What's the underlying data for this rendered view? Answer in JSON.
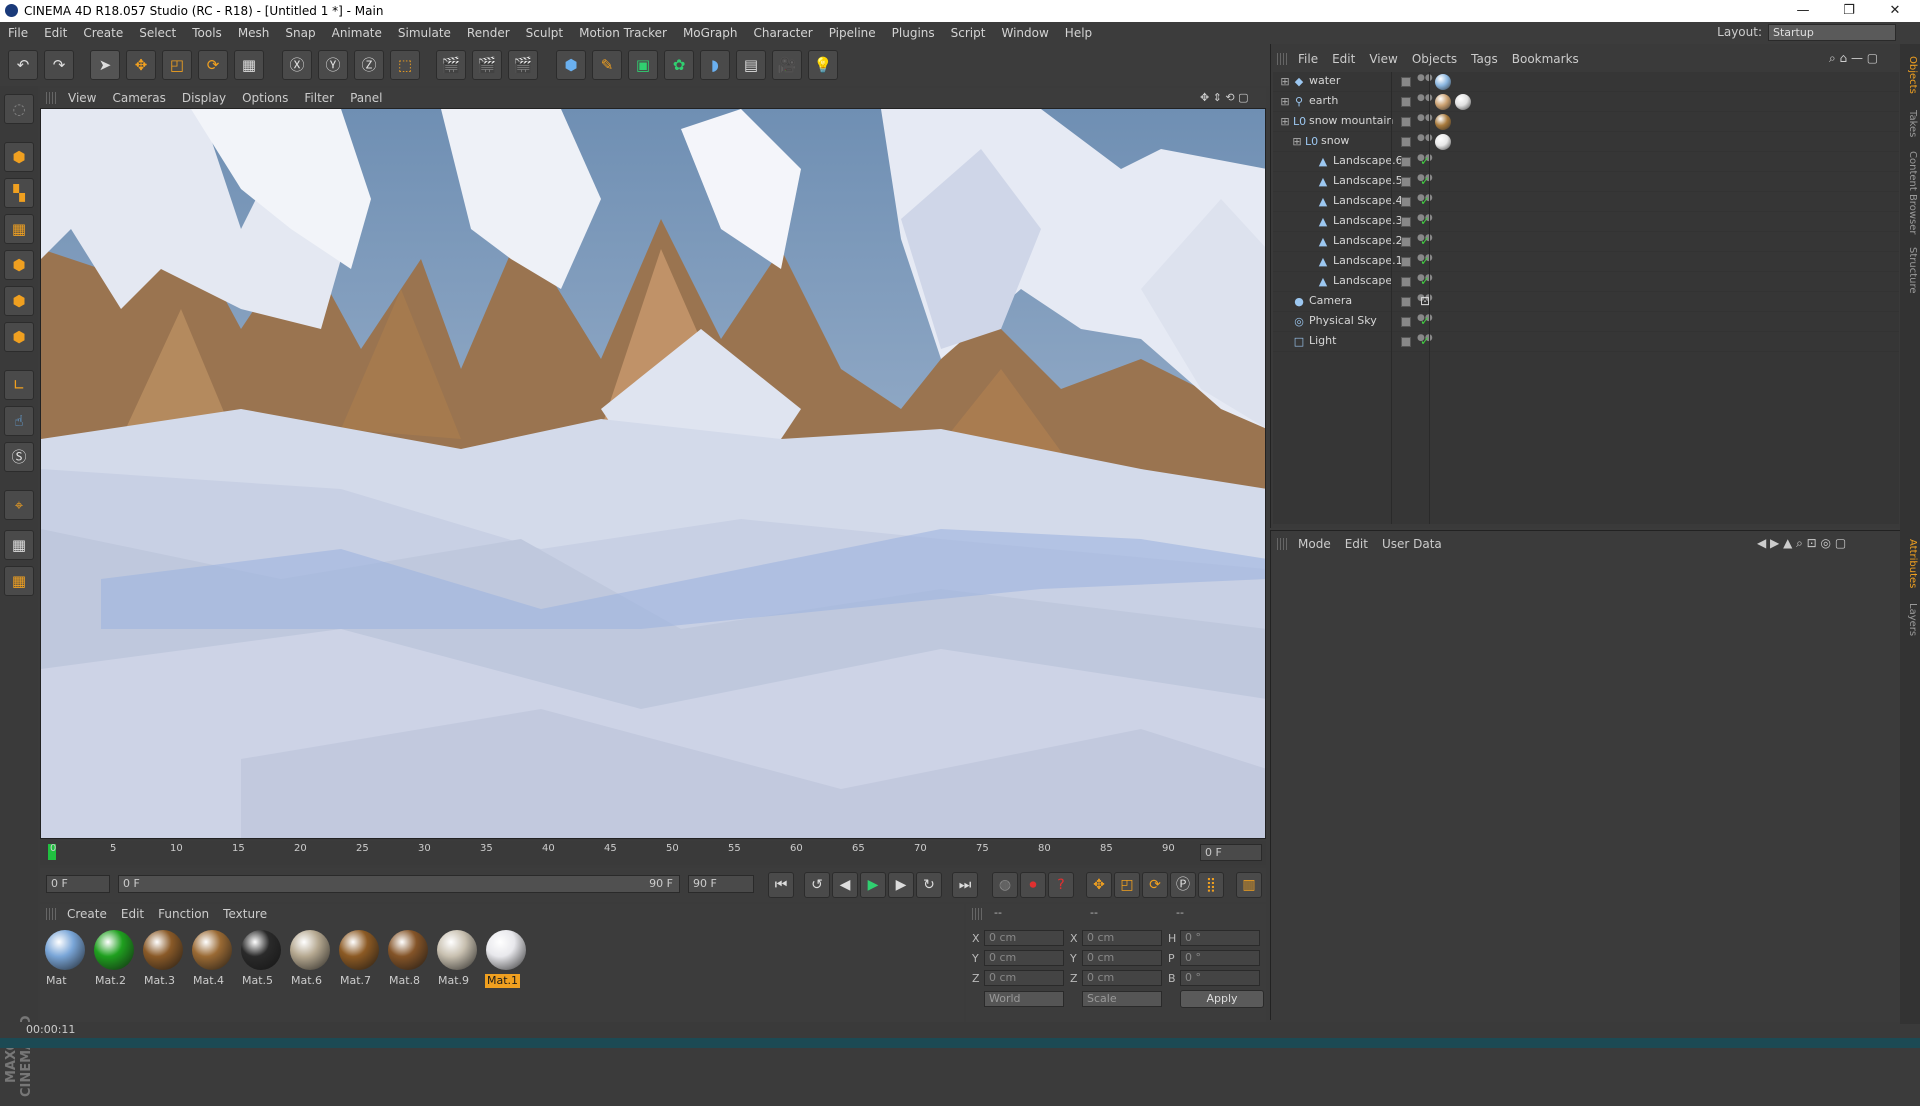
{
  "titlebar": {
    "title": "CINEMA 4D R18.057 Studio (RC - R18) - [Untitled 1 *] - Main",
    "minimize": "—",
    "maximize": "❐",
    "close": "✕"
  },
  "menu": [
    "File",
    "Edit",
    "Create",
    "Select",
    "Tools",
    "Mesh",
    "Snap",
    "Animate",
    "Simulate",
    "Render",
    "Sculpt",
    "Motion Tracker",
    "MoGraph",
    "Character",
    "Pipeline",
    "Plugins",
    "Script",
    "Window",
    "Help"
  ],
  "layout": {
    "label": "Layout:",
    "value": "Startup"
  },
  "viewport_menu": [
    "View",
    "Cameras",
    "Display",
    "Options",
    "Filter",
    "Panel"
  ],
  "timeline": {
    "ticks": [
      "0",
      "5",
      "10",
      "15",
      "20",
      "25",
      "30",
      "35",
      "40",
      "45",
      "50",
      "55",
      "60",
      "65",
      "70",
      "75",
      "80",
      "85",
      "90"
    ],
    "current_frame": "0 F",
    "start_field": "0 F",
    "range_start": "0 F",
    "range_end": "90 F",
    "end_field": "90 F"
  },
  "material_menu": [
    "Create",
    "Edit",
    "Function",
    "Texture"
  ],
  "materials": [
    {
      "name": "Mat",
      "color": "#7aa6d8"
    },
    {
      "name": "Mat.2",
      "color": "#1fa01f"
    },
    {
      "name": "Mat.3",
      "color": "#8a5a28"
    },
    {
      "name": "Mat.4",
      "color": "#9a6a34"
    },
    {
      "name": "Mat.5",
      "color": "#2a2a2a"
    },
    {
      "name": "Mat.6",
      "color": "#b5a890"
    },
    {
      "name": "Mat.7",
      "color": "#8c5a24"
    },
    {
      "name": "Mat.8",
      "color": "#845428"
    },
    {
      "name": "Mat.9",
      "color": "#c8c0b0"
    },
    {
      "name": "Mat.1",
      "color": "#e8e8ec",
      "selected": true
    }
  ],
  "coords": {
    "dashes": [
      "--",
      "--",
      "--"
    ],
    "rows": [
      {
        "a": "X",
        "av": "0 cm",
        "b": "X",
        "bv": "0 cm",
        "c": "H",
        "cv": "0 °"
      },
      {
        "a": "Y",
        "av": "0 cm",
        "b": "Y",
        "bv": "0 cm",
        "c": "P",
        "cv": "0 °"
      },
      {
        "a": "Z",
        "av": "0 cm",
        "b": "Z",
        "bv": "0 cm",
        "c": "B",
        "cv": "0 °"
      }
    ],
    "world": "World",
    "scale": "Scale",
    "apply": "Apply"
  },
  "objects_menu": [
    "File",
    "Edit",
    "View",
    "Objects",
    "Tags",
    "Bookmarks"
  ],
  "objects": [
    {
      "name": "water",
      "indent": 0,
      "icon": "◆",
      "tags": [
        "#8ab6e0"
      ]
    },
    {
      "name": "earth",
      "indent": 0,
      "icon": "⚲",
      "tags": [
        "#caa070",
        "#e0e0e0"
      ]
    },
    {
      "name": "snow mountain",
      "indent": 0,
      "icon": "L0",
      "tags": [
        "#a87a3c"
      ]
    },
    {
      "name": "snow",
      "indent": 1,
      "icon": "L0",
      "tags": [
        "#e8e8e8"
      ]
    },
    {
      "name": "Landscape.6",
      "indent": 2,
      "icon": "▲",
      "check": true
    },
    {
      "name": "Landscape.5",
      "indent": 2,
      "icon": "▲",
      "check": true
    },
    {
      "name": "Landscape.4",
      "indent": 2,
      "icon": "▲",
      "check": true
    },
    {
      "name": "Landscape.3",
      "indent": 2,
      "icon": "▲",
      "check": true
    },
    {
      "name": "Landscape.2",
      "indent": 2,
      "icon": "▲",
      "check": true
    },
    {
      "name": "Landscape.1",
      "indent": 2,
      "icon": "▲",
      "check": true
    },
    {
      "name": "Landscape",
      "indent": 2,
      "icon": "▲",
      "check": true
    },
    {
      "name": "Camera",
      "indent": 0,
      "icon": "●",
      "camtag": true
    },
    {
      "name": "Physical Sky",
      "indent": 0,
      "icon": "◎",
      "check": true
    },
    {
      "name": "Light",
      "indent": 0,
      "icon": "□",
      "check": true
    }
  ],
  "attributes_menu": [
    "Mode",
    "Edit",
    "User Data"
  ],
  "right_tabs": [
    "Objects",
    "Takes",
    "Content Browser",
    "Structure",
    "Attributes",
    "Layers"
  ],
  "status": "00:00:11",
  "brand": "MAXON CINEMA 4D"
}
